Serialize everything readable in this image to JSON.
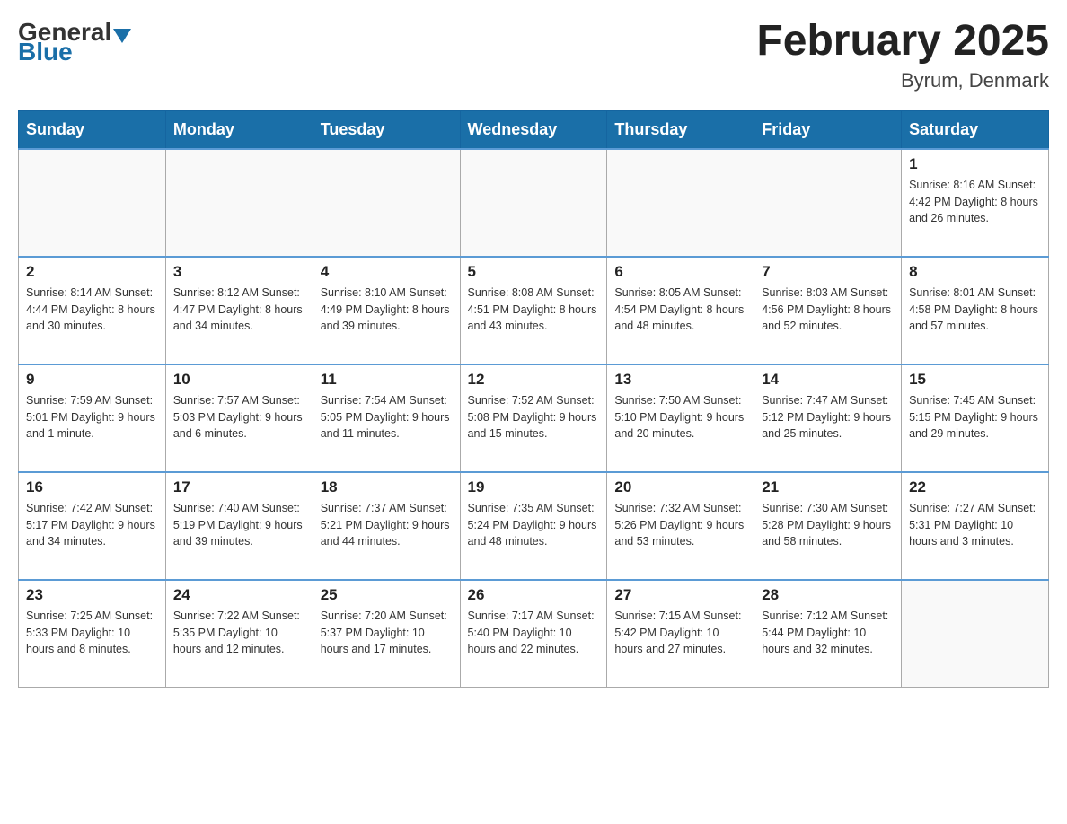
{
  "logo": {
    "general": "General",
    "blue": "Blue"
  },
  "title": "February 2025",
  "location": "Byrum, Denmark",
  "days_of_week": [
    "Sunday",
    "Monday",
    "Tuesday",
    "Wednesday",
    "Thursday",
    "Friday",
    "Saturday"
  ],
  "weeks": [
    [
      {
        "day": "",
        "info": ""
      },
      {
        "day": "",
        "info": ""
      },
      {
        "day": "",
        "info": ""
      },
      {
        "day": "",
        "info": ""
      },
      {
        "day": "",
        "info": ""
      },
      {
        "day": "",
        "info": ""
      },
      {
        "day": "1",
        "info": "Sunrise: 8:16 AM\nSunset: 4:42 PM\nDaylight: 8 hours\nand 26 minutes."
      }
    ],
    [
      {
        "day": "2",
        "info": "Sunrise: 8:14 AM\nSunset: 4:44 PM\nDaylight: 8 hours\nand 30 minutes."
      },
      {
        "day": "3",
        "info": "Sunrise: 8:12 AM\nSunset: 4:47 PM\nDaylight: 8 hours\nand 34 minutes."
      },
      {
        "day": "4",
        "info": "Sunrise: 8:10 AM\nSunset: 4:49 PM\nDaylight: 8 hours\nand 39 minutes."
      },
      {
        "day": "5",
        "info": "Sunrise: 8:08 AM\nSunset: 4:51 PM\nDaylight: 8 hours\nand 43 minutes."
      },
      {
        "day": "6",
        "info": "Sunrise: 8:05 AM\nSunset: 4:54 PM\nDaylight: 8 hours\nand 48 minutes."
      },
      {
        "day": "7",
        "info": "Sunrise: 8:03 AM\nSunset: 4:56 PM\nDaylight: 8 hours\nand 52 minutes."
      },
      {
        "day": "8",
        "info": "Sunrise: 8:01 AM\nSunset: 4:58 PM\nDaylight: 8 hours\nand 57 minutes."
      }
    ],
    [
      {
        "day": "9",
        "info": "Sunrise: 7:59 AM\nSunset: 5:01 PM\nDaylight: 9 hours\nand 1 minute."
      },
      {
        "day": "10",
        "info": "Sunrise: 7:57 AM\nSunset: 5:03 PM\nDaylight: 9 hours\nand 6 minutes."
      },
      {
        "day": "11",
        "info": "Sunrise: 7:54 AM\nSunset: 5:05 PM\nDaylight: 9 hours\nand 11 minutes."
      },
      {
        "day": "12",
        "info": "Sunrise: 7:52 AM\nSunset: 5:08 PM\nDaylight: 9 hours\nand 15 minutes."
      },
      {
        "day": "13",
        "info": "Sunrise: 7:50 AM\nSunset: 5:10 PM\nDaylight: 9 hours\nand 20 minutes."
      },
      {
        "day": "14",
        "info": "Sunrise: 7:47 AM\nSunset: 5:12 PM\nDaylight: 9 hours\nand 25 minutes."
      },
      {
        "day": "15",
        "info": "Sunrise: 7:45 AM\nSunset: 5:15 PM\nDaylight: 9 hours\nand 29 minutes."
      }
    ],
    [
      {
        "day": "16",
        "info": "Sunrise: 7:42 AM\nSunset: 5:17 PM\nDaylight: 9 hours\nand 34 minutes."
      },
      {
        "day": "17",
        "info": "Sunrise: 7:40 AM\nSunset: 5:19 PM\nDaylight: 9 hours\nand 39 minutes."
      },
      {
        "day": "18",
        "info": "Sunrise: 7:37 AM\nSunset: 5:21 PM\nDaylight: 9 hours\nand 44 minutes."
      },
      {
        "day": "19",
        "info": "Sunrise: 7:35 AM\nSunset: 5:24 PM\nDaylight: 9 hours\nand 48 minutes."
      },
      {
        "day": "20",
        "info": "Sunrise: 7:32 AM\nSunset: 5:26 PM\nDaylight: 9 hours\nand 53 minutes."
      },
      {
        "day": "21",
        "info": "Sunrise: 7:30 AM\nSunset: 5:28 PM\nDaylight: 9 hours\nand 58 minutes."
      },
      {
        "day": "22",
        "info": "Sunrise: 7:27 AM\nSunset: 5:31 PM\nDaylight: 10 hours\nand 3 minutes."
      }
    ],
    [
      {
        "day": "23",
        "info": "Sunrise: 7:25 AM\nSunset: 5:33 PM\nDaylight: 10 hours\nand 8 minutes."
      },
      {
        "day": "24",
        "info": "Sunrise: 7:22 AM\nSunset: 5:35 PM\nDaylight: 10 hours\nand 12 minutes."
      },
      {
        "day": "25",
        "info": "Sunrise: 7:20 AM\nSunset: 5:37 PM\nDaylight: 10 hours\nand 17 minutes."
      },
      {
        "day": "26",
        "info": "Sunrise: 7:17 AM\nSunset: 5:40 PM\nDaylight: 10 hours\nand 22 minutes."
      },
      {
        "day": "27",
        "info": "Sunrise: 7:15 AM\nSunset: 5:42 PM\nDaylight: 10 hours\nand 27 minutes."
      },
      {
        "day": "28",
        "info": "Sunrise: 7:12 AM\nSunset: 5:44 PM\nDaylight: 10 hours\nand 32 minutes."
      },
      {
        "day": "",
        "info": ""
      }
    ]
  ]
}
